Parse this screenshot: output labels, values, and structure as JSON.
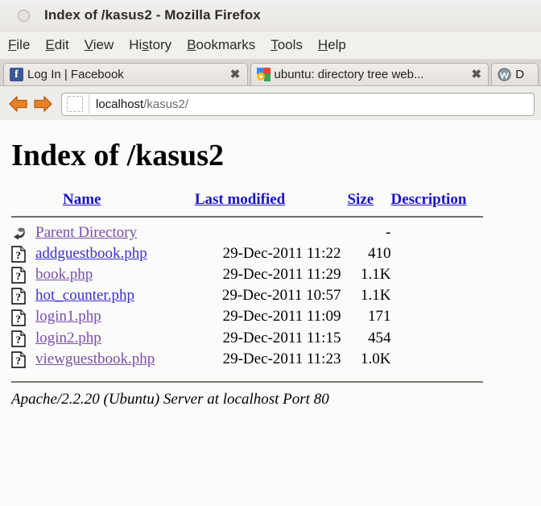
{
  "window": {
    "title": "Index of /kasus2 - Mozilla Firefox",
    "window_control_icon": "window-menu-dot"
  },
  "menubar": {
    "items": [
      {
        "label": "File",
        "mnemonic": "F"
      },
      {
        "label": "Edit",
        "mnemonic": "E"
      },
      {
        "label": "View",
        "mnemonic": "V"
      },
      {
        "label": "History",
        "mnemonic": "s"
      },
      {
        "label": "Bookmarks",
        "mnemonic": "B"
      },
      {
        "label": "Tools",
        "mnemonic": "T"
      },
      {
        "label": "Help",
        "mnemonic": "H"
      }
    ]
  },
  "tabs": [
    {
      "label": "Log In | Facebook",
      "favicon": "facebook-icon",
      "close_label": "✖"
    },
    {
      "label": "ubuntu: directory tree web...",
      "favicon": "google-icon",
      "close_label": "✖"
    },
    {
      "label": "D",
      "favicon": "wordpress-icon",
      "close_label": ""
    }
  ],
  "navbar": {
    "back_icon": "back-arrow-icon",
    "forward_icon": "forward-arrow-icon",
    "site_identity_icon": "blank-favicon-placeholder",
    "url_host": "localhost",
    "url_path": "/kasus2/",
    "url_full": "localhost/kasus2/"
  },
  "page": {
    "heading": "Index of /kasus2",
    "columns": [
      "Name",
      "Last modified",
      "Size",
      "Description"
    ],
    "parent": {
      "icon": "back-arrow-icon",
      "label": "Parent Directory",
      "last_modified": "",
      "size": "-",
      "description": ""
    },
    "rows": [
      {
        "icon": "unknown-file-icon",
        "name": "addguestbook.php",
        "last_modified": "29-Dec-2011 11:22",
        "size": "410",
        "description": ""
      },
      {
        "icon": "unknown-file-icon",
        "name": "book.php",
        "last_modified": "29-Dec-2011 11:29",
        "size": "1.1K",
        "description": ""
      },
      {
        "icon": "unknown-file-icon",
        "name": "hot_counter.php",
        "last_modified": "29-Dec-2011 10:57",
        "size": "1.1K",
        "description": ""
      },
      {
        "icon": "unknown-file-icon",
        "name": "login1.php",
        "last_modified": "29-Dec-2011 11:09",
        "size": "171",
        "description": ""
      },
      {
        "icon": "unknown-file-icon",
        "name": "login2.php",
        "last_modified": "29-Dec-2011 11:15",
        "size": "454",
        "description": ""
      },
      {
        "icon": "unknown-file-icon",
        "name": "viewguestbook.php",
        "last_modified": "29-Dec-2011 11:23",
        "size": "1.0K",
        "description": ""
      }
    ],
    "footer": "Apache/2.2.20 (Ubuntu) Server at localhost Port 80"
  },
  "colors": {
    "link": "#3b2fd0",
    "visited_link": "#7a4fa8",
    "header_link": "#1a12c8",
    "chrome_bg": "#efedea",
    "page_bg": "#fbfbfa",
    "nav_arrow": "#e07820"
  }
}
